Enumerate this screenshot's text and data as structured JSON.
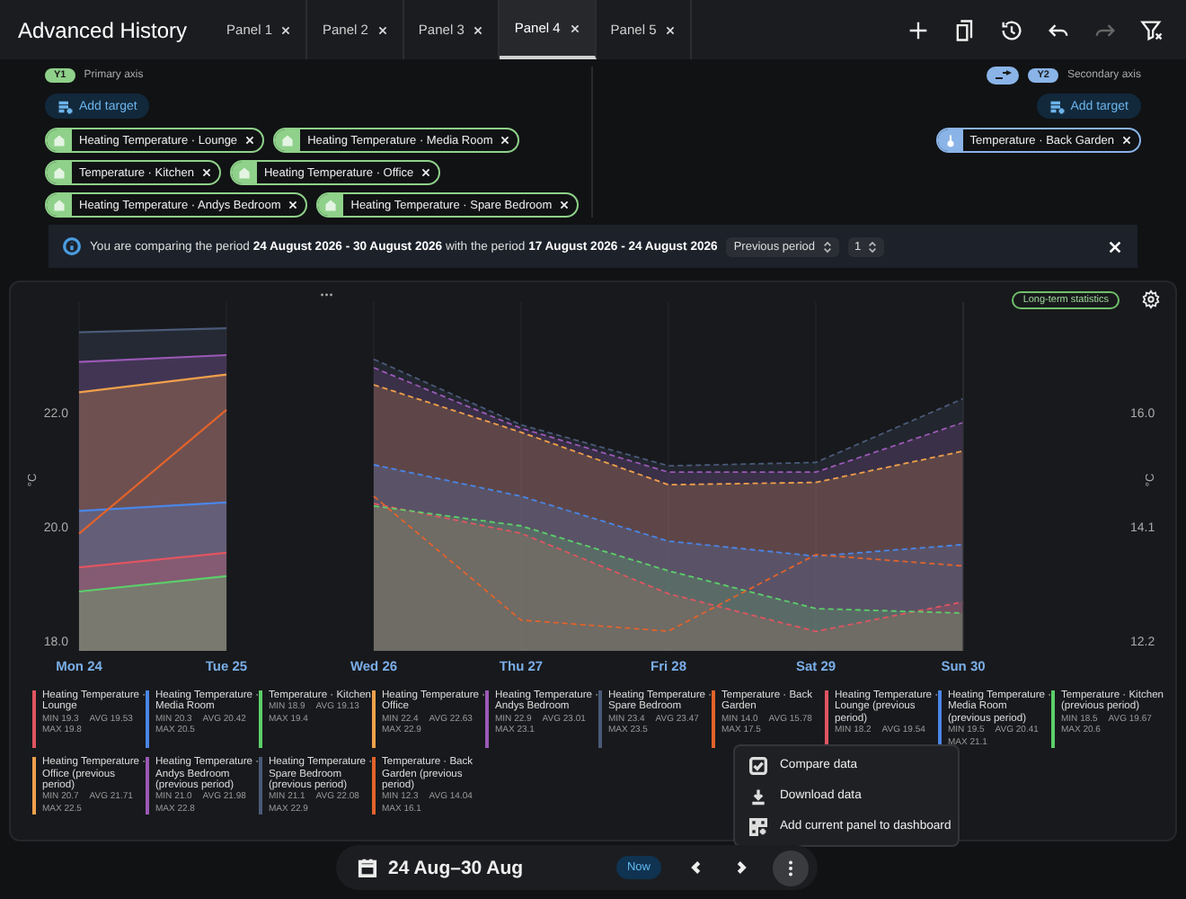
{
  "app_bar": {
    "title": "Advanced History",
    "tabs": [
      {
        "label": "Panel 1",
        "selected": false
      },
      {
        "label": "Panel 2",
        "selected": false
      },
      {
        "label": "Panel 3",
        "selected": false
      },
      {
        "label": "Panel 4",
        "selected": true
      },
      {
        "label": "Panel 5",
        "selected": false
      }
    ],
    "actions": [
      {
        "disabled": false
      },
      {
        "disabled": false
      },
      {
        "disabled": false
      },
      {
        "disabled": false
      },
      {
        "disabled": true
      },
      {
        "disabled": false
      }
    ]
  },
  "targets": {
    "primary": {
      "badge": "Y1",
      "label": "Primary axis",
      "add_button": "Add target",
      "chips": [
        {
          "label": "Heating Temperature · Lounge"
        },
        {
          "label": "Heating Temperature · Media Room"
        },
        {
          "label": "Temperature · Kitchen"
        },
        {
          "label": "Heating Temperature · Office"
        },
        {
          "label": "Heating Temperature · Andys Bedroom"
        },
        {
          "label": "Heating Temperature · Spare Bedroom"
        }
      ]
    },
    "secondary": {
      "badge": "Y2",
      "label": "Secondary axis",
      "add_button": "Add target",
      "chips": [
        {
          "label": "Temperature · Back Garden"
        }
      ]
    }
  },
  "comparison_bar": {
    "message": "You are comparing the period **24 August 2026 - 30 August 2026** with the period **17 August 2026 - 24 August 2026**",
    "period_select": "Previous period",
    "count_select": "1"
  },
  "chart": {
    "badge": "Long-term statistics",
    "chart_data": {
      "type": "area",
      "grid": true,
      "categories": [
        "Mon 24",
        "Tue 25",
        "Wed 26",
        "Thu 27",
        "Fri 28",
        "Sat 29",
        "Sun 30"
      ],
      "ylabel": "°C",
      "ylim": [
        17.84,
        23.95
      ],
      "yticks": [
        {
          "value": 18,
          "label": "18.0"
        },
        {
          "value": 20,
          "label": "20.0"
        },
        {
          "value": 22,
          "label": "22.0"
        }
      ],
      "series": [
        {
          "color": "#4a5a78",
          "line_style": "solid",
          "values": [
            23.42,
            23.49,
            null,
            null,
            null,
            null,
            null
          ]
        },
        {
          "color": "#9b59b6",
          "line_style": "solid",
          "values": [
            22.9,
            23.02,
            null,
            null,
            null,
            null,
            null
          ]
        },
        {
          "color": "#f0a04b",
          "line_style": "solid",
          "values": [
            22.37,
            22.68,
            null,
            null,
            null,
            null,
            null
          ]
        },
        {
          "color": "#4a86e8",
          "line_style": "solid",
          "values": [
            20.29,
            20.44,
            null,
            null,
            null,
            null,
            null
          ]
        },
        {
          "color": "#e05561",
          "line_style": "solid",
          "values": [
            19.3,
            19.56,
            null,
            null,
            null,
            null,
            null
          ]
        },
        {
          "color": "#5ccf6a",
          "line_style": "solid",
          "values": [
            18.88,
            19.15,
            null,
            null,
            null,
            null,
            null
          ]
        },
        {
          "color": "#4a5a78",
          "line_style": "dashed",
          "values": [
            null,
            null,
            22.95,
            21.8,
            21.08,
            21.14,
            22.26
          ]
        },
        {
          "color": "#9b59b6",
          "line_style": "dashed",
          "values": [
            null,
            null,
            22.8,
            21.74,
            20.97,
            20.97,
            21.84
          ]
        },
        {
          "color": "#f0a04b",
          "line_style": "dashed",
          "values": [
            null,
            null,
            22.5,
            21.67,
            20.75,
            20.79,
            21.34
          ]
        },
        {
          "color": "#4a86e8",
          "line_style": "dashed",
          "values": [
            null,
            null,
            21.1,
            20.55,
            19.76,
            19.5,
            19.7
          ]
        },
        {
          "color": "#e05561",
          "line_style": "dashed",
          "values": [
            null,
            null,
            20.42,
            19.9,
            18.84,
            18.18,
            18.7
          ]
        },
        {
          "color": "#5ccf6a",
          "line_style": "dashed",
          "values": [
            null,
            null,
            20.38,
            20.03,
            19.24,
            18.58,
            18.5
          ]
        }
      ]
    },
    "secondary_chart": {
      "chart_data": {
        "type": "line",
        "ylabel": "°C",
        "ylim": [
          12.05,
          17.85
        ],
        "yticks": [
          {
            "value": 12.2,
            "label": "12.2"
          },
          {
            "value": 14.1,
            "label": "14.1"
          },
          {
            "value": 16,
            "label": "16.0"
          }
        ],
        "series": [
          {
            "color": "#e2632b",
            "line_style": "solid",
            "values": [
              14.0,
              16.06,
              null,
              null,
              null,
              null,
              null
            ]
          },
          {
            "color": "#e2632b",
            "line_style": "dashed",
            "values": [
              null,
              null,
              14.62,
              12.56,
              12.38,
              13.65,
              13.46
            ]
          }
        ]
      }
    },
    "legend": [
      {
        "name": "Heating Temperature · Lounge",
        "color": "#e05561",
        "stats": [
          {
            "label": "MIN",
            "value": "19.3"
          },
          {
            "label": "AVG",
            "value": "19.53"
          },
          {
            "label": "MAX",
            "value": "19.8"
          }
        ]
      },
      {
        "name": "Heating Temperature · Media Room",
        "color": "#4a86e8",
        "stats": [
          {
            "label": "MIN",
            "value": "20.3"
          },
          {
            "label": "AVG",
            "value": "20.42"
          },
          {
            "label": "MAX",
            "value": "20.5"
          }
        ]
      },
      {
        "name": "Temperature · Kitchen",
        "color": "#5ccf6a",
        "stats": [
          {
            "label": "MIN",
            "value": "18.9"
          },
          {
            "label": "AVG",
            "value": "19.13"
          },
          {
            "label": "MAX",
            "value": "19.4"
          }
        ]
      },
      {
        "name": "Heating Temperature · Office",
        "color": "#f0a04b",
        "stats": [
          {
            "label": "MIN",
            "value": "22.4"
          },
          {
            "label": "AVG",
            "value": "22.63"
          },
          {
            "label": "MAX",
            "value": "22.9"
          }
        ]
      },
      {
        "name": "Heating Temperature · Andys Bedroom",
        "color": "#9b59b6",
        "stats": [
          {
            "label": "MIN",
            "value": "22.9"
          },
          {
            "label": "AVG",
            "value": "23.01"
          },
          {
            "label": "MAX",
            "value": "23.1"
          }
        ]
      },
      {
        "name": "Heating Temperature · Spare Bedroom",
        "color": "#4a5a78",
        "stats": [
          {
            "label": "MIN",
            "value": "23.4"
          },
          {
            "label": "AVG",
            "value": "23.47"
          },
          {
            "label": "MAX",
            "value": "23.5"
          }
        ]
      },
      {
        "name": "Temperature · Back Garden",
        "color": "#e2632b",
        "stats": [
          {
            "label": "MIN",
            "value": "14.0"
          },
          {
            "label": "AVG",
            "value": "15.78"
          },
          {
            "label": "MAX",
            "value": "17.5"
          }
        ]
      },
      {
        "name": "Heating Temperature · Lounge (previous period)",
        "color": "#e05561",
        "stats": [
          {
            "label": "MIN",
            "value": "18.2"
          },
          {
            "label": "AVG",
            "value": "19.54"
          }
        ]
      },
      {
        "name": "Heating Temperature · Media Room (previous period)",
        "color": "#4a86e8",
        "stats": [
          {
            "label": "MIN",
            "value": "19.5"
          },
          {
            "label": "AVG",
            "value": "20.41"
          },
          {
            "label": "MAX",
            "value": "21.1"
          }
        ]
      },
      {
        "name": "Temperature · Kitchen (previous period)",
        "color": "#5ccf6a",
        "stats": [
          {
            "label": "MIN",
            "value": "18.5"
          },
          {
            "label": "AVG",
            "value": "19.67"
          },
          {
            "label": "MAX",
            "value": "20.6"
          }
        ]
      },
      {
        "name": "Heating Temperature · Office (previous period)",
        "color": "#f0a04b",
        "stats": [
          {
            "label": "MIN",
            "value": "20.7"
          },
          {
            "label": "AVG",
            "value": "21.71"
          },
          {
            "label": "MAX",
            "value": "22.5"
          }
        ]
      },
      {
        "name": "Heating Temperature · Andys Bedroom (previous period)",
        "color": "#9b59b6",
        "stats": [
          {
            "label": "MIN",
            "value": "21.0"
          },
          {
            "label": "AVG",
            "value": "21.98"
          },
          {
            "label": "MAX",
            "value": "22.8"
          }
        ]
      },
      {
        "name": "Heating Temperature · Spare Bedroom (previous period)",
        "color": "#4a5a78",
        "stats": [
          {
            "label": "MIN",
            "value": "21.1"
          },
          {
            "label": "AVG",
            "value": "22.08"
          },
          {
            "label": "MAX",
            "value": "22.9"
          }
        ]
      },
      {
        "name": "Temperature · Back Garden (previous period)",
        "color": "#e2632b",
        "stats": [
          {
            "label": "MIN",
            "value": "12.3"
          },
          {
            "label": "AVG",
            "value": "14.04"
          },
          {
            "label": "MAX",
            "value": "16.1"
          }
        ]
      }
    ]
  },
  "menu": {
    "items": [
      {
        "kind": "checkbox",
        "label": "Compare data",
        "checked": true
      },
      {
        "kind": "download",
        "label": "Download data"
      },
      {
        "kind": "add-to-dashboard",
        "label": "Add current panel to dashboard"
      }
    ]
  },
  "date_bar": {
    "range": "24 Aug–30 Aug",
    "now_button": "Now",
    "more_open": true
  }
}
